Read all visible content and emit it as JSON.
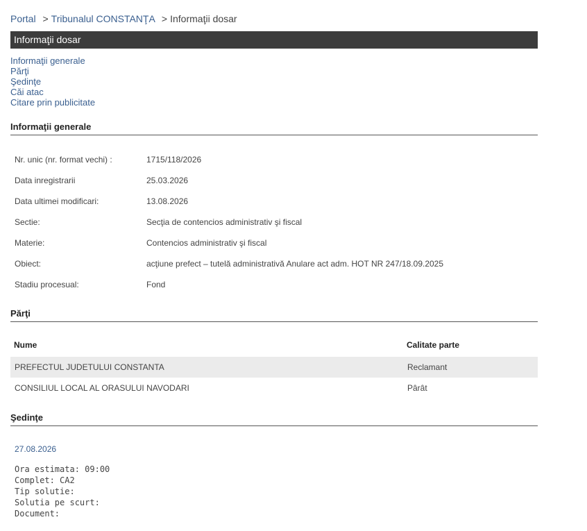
{
  "breadcrumb": {
    "portal": "Portal",
    "court": "Tribunalul CONSTANŢA",
    "current": "Informaţii dosar",
    "separator": ">"
  },
  "header": {
    "title": "Informaţii dosar"
  },
  "nav": {
    "items": [
      "Informaţii generale",
      "Părţi",
      "Şedinţe",
      "Căi atac",
      "Citare prin publicitate"
    ]
  },
  "general": {
    "title": "Informaţii generale",
    "rows": [
      {
        "label": "Nr. unic (nr. format vechi) :",
        "value": "1715/118/2026"
      },
      {
        "label": "Data inregistrarii",
        "value": "25.03.2026"
      },
      {
        "label": "Data ultimei modificari:",
        "value": "13.08.2026"
      },
      {
        "label": "Sectie:",
        "value": "Secţia de contencios administrativ şi fiscal"
      },
      {
        "label": "Materie:",
        "value": "Contencios administrativ şi fiscal"
      },
      {
        "label": "Obiect:",
        "value": "acţiune prefect – tutelă administrativă Anulare act adm. HOT NR 247/18.09.2025"
      },
      {
        "label": "Stadiu procesual:",
        "value": "Fond"
      }
    ]
  },
  "parti": {
    "title": "Părţi",
    "headers": {
      "name": "Nume",
      "role": "Calitate parte"
    },
    "rows": [
      {
        "name": "PREFECTUL JUDETULUI CONSTANTA",
        "role": "Reclamant"
      },
      {
        "name": "CONSILIUL LOCAL AL ORASULUI NAVODARI",
        "role": "Pârât"
      }
    ]
  },
  "sedinte": {
    "title": "Şedinţe",
    "date": "27.08.2026",
    "lines": [
      "Ora estimata: 09:00",
      "Complet: CA2",
      "Tip solutie:",
      "Solutia pe scurt:",
      "Document:"
    ]
  }
}
